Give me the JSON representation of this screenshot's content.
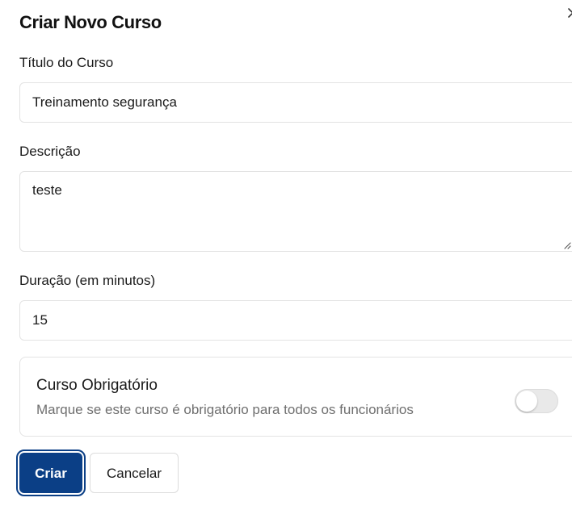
{
  "dialog": {
    "title": "Criar Novo Curso",
    "close_icon": "close-icon"
  },
  "form": {
    "title_label": "Título do Curso",
    "title_value": "Treinamento segurança",
    "description_label": "Descrição",
    "description_value": "teste",
    "duration_label": "Duração (em minutos)",
    "duration_value": "15",
    "mandatory": {
      "title": "Curso Obrigatório",
      "description": "Marque se este curso é obrigatório para todos os funcionários",
      "checked": false
    }
  },
  "actions": {
    "create_label": "Criar",
    "cancel_label": "Cancelar"
  },
  "colors": {
    "primary": "#0b3f86",
    "muted_text": "#6f6f6f",
    "border": "#e3e3e3"
  }
}
